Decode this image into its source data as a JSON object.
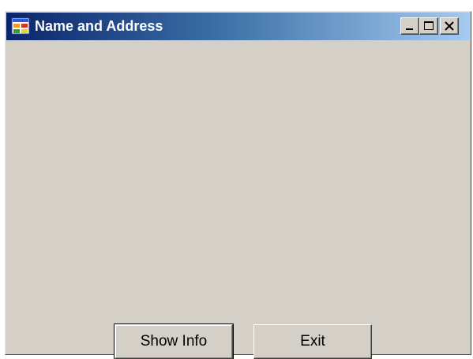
{
  "window": {
    "title": "Name and Address",
    "icon": "form-app-icon",
    "controls": {
      "minimize": "minimize-icon",
      "maximize": "maximize-icon",
      "close": "close-icon"
    }
  },
  "buttons": {
    "show_info_label": "Show Info",
    "exit_label": "Exit"
  },
  "colors": {
    "face": "#d4d0c8",
    "titlebar_start": "#0a246a",
    "titlebar_end": "#a6caf0",
    "title_text": "#ffffff"
  }
}
